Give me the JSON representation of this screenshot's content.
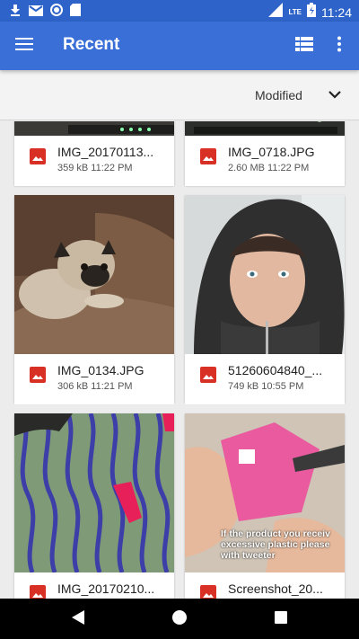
{
  "status_bar": {
    "time": "11:24",
    "network": "LTE",
    "icons": [
      "download-icon",
      "gmail-icon",
      "sync-icon",
      "sd-card-icon",
      "signal-icon",
      "battery-charging-icon"
    ]
  },
  "app_bar": {
    "title": "Recent",
    "icons": [
      "menu-icon",
      "list-view-icon",
      "more-vert-icon"
    ]
  },
  "sort": {
    "label": "Modified"
  },
  "files": [
    {
      "name": "IMG_20170113...",
      "meta": "359 kB 11:22 PM"
    },
    {
      "name": "IMG_0718.JPG",
      "meta": "2.60 MB 11:22 PM"
    },
    {
      "name": "IMG_0134.JPG",
      "meta": "306 kB 11:21 PM"
    },
    {
      "name": "51260604840_...",
      "meta": "749 kB 10:55 PM"
    },
    {
      "name": "IMG_20170210...",
      "meta": ""
    },
    {
      "name": "Screenshot_20...",
      "meta": ""
    }
  ],
  "thumbnail_captions": {
    "screenshot_overlay": [
      "If the product you receiv",
      "excessive plastic please",
      "with tweeter"
    ]
  },
  "colors": {
    "status_bar": "#2e63c9",
    "app_bar": "#3a6fd8",
    "file_icon": "#d93025"
  }
}
